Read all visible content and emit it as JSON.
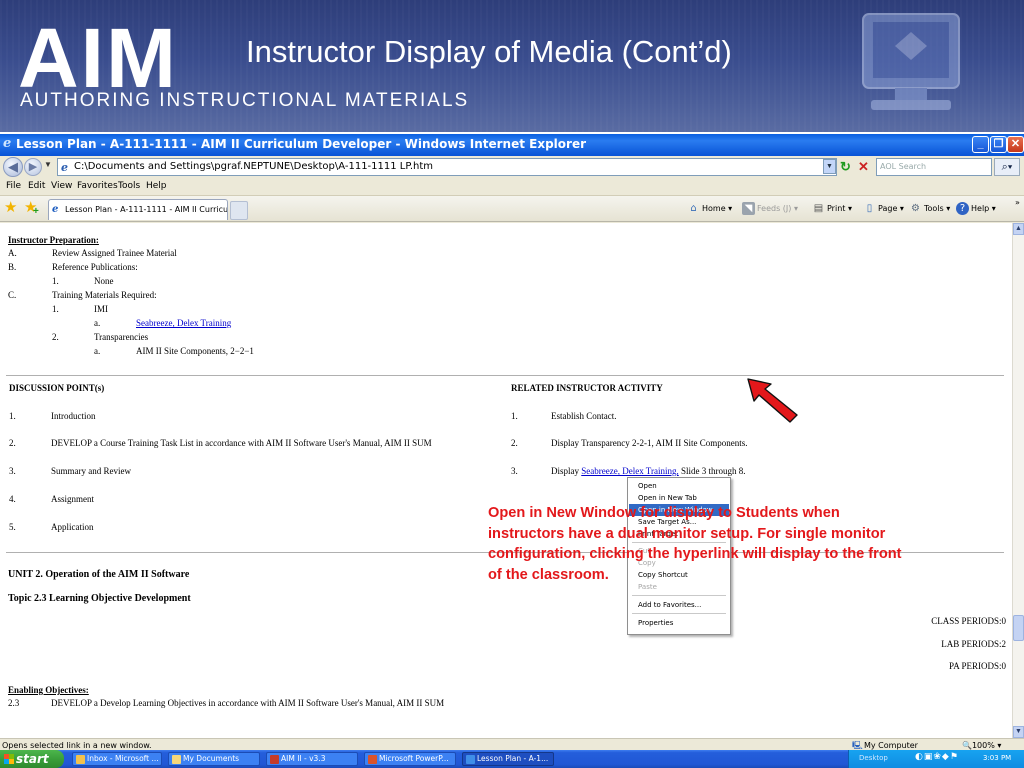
{
  "slide": {
    "logo": "AIM",
    "logo_subtitle": "AUTHORING INSTRUCTIONAL MATERIALS",
    "title": "Instructor Display of Media (Cont’d)"
  },
  "browser": {
    "window_title": "Lesson Plan - A-111-1111 - AIM II Curriculum Developer - Windows Internet Explorer",
    "address": "C:\\Documents and Settings\\pgraf.NEPTUNE\\Desktop\\A-111-1111 LP.htm",
    "search_placeholder": "AOL Search",
    "menu": [
      "File",
      "Edit",
      "View",
      "Favorites",
      "Tools",
      "Help"
    ],
    "tab_title": "Lesson Plan - A-111-1111 - AIM II Curriculu...",
    "commands": {
      "home": "Home",
      "feeds": "Feeds (J)",
      "print": "Print",
      "page": "Page",
      "tools": "Tools",
      "help": "Help"
    },
    "status_text": "Opens selected link in a new window.",
    "zone": "My Computer",
    "zoom": "100%"
  },
  "doc": {
    "prep_heading": "Instructor Preparation:",
    "prep": [
      {
        "num": "A.",
        "text": "Review Assigned Trainee Material"
      },
      {
        "num": "B.",
        "text": "Reference Publications:"
      },
      {
        "num": "1.",
        "text": "None"
      },
      {
        "num": "C.",
        "text": "Training Materials Required:"
      },
      {
        "num": "1.",
        "text": "IMI"
      },
      {
        "num": "a.",
        "text": "Seabreeze, Delex Training"
      },
      {
        "num": "2.",
        "text": "Transparencies"
      },
      {
        "num": "a.",
        "text": "AIM II Site Components, 2−2−1"
      }
    ],
    "discussion_heading": "DISCUSSION POINT(s)",
    "activity_heading": "RELATED INSTRUCTOR ACTIVITY",
    "discussion": [
      {
        "num": "1.",
        "text": "Introduction"
      },
      {
        "num": "2.",
        "text": "DEVELOP a Course Training Task List in accordance with AIM II Software User's Manual, AIM II SUM"
      },
      {
        "num": "3.",
        "text": "Summary and Review"
      },
      {
        "num": "4.",
        "text": "Assignment"
      },
      {
        "num": "5.",
        "text": "Application"
      }
    ],
    "activity": [
      {
        "num": "1.",
        "text": "Establish Contact."
      },
      {
        "num": "2.",
        "text": "Display Transparency 2-2-1, AIM II Site Components."
      },
      {
        "num": "3.",
        "pre": "Display ",
        "link": "Seabreeze, Delex Training,",
        "post": " Slide 3 through 8."
      }
    ],
    "unit_title": "UNIT 2. Operation of the AIM II Software",
    "topic_title": "Topic 2.3 Learning Objective Development",
    "periods": [
      "CLASS PERIODS:0",
      "LAB PERIODS:2",
      "PA PERIODS:0"
    ],
    "enabling_heading": "Enabling Objectives:",
    "enabling": {
      "num": "2.3",
      "text": "DEVELOP a Develop Learning Objectives in accordance with AIM II Software User's Manual, AIM II SUM"
    }
  },
  "context_menu": {
    "items": [
      {
        "label": "Open",
        "state": "normal"
      },
      {
        "label": "Open in New Tab",
        "state": "normal"
      },
      {
        "label": "Open in New Window",
        "state": "highlighted"
      },
      {
        "label": "Save Target As...",
        "state": "normal"
      },
      {
        "label": "Print Target",
        "state": "normal"
      },
      {
        "label": "Cut",
        "state": "disabled"
      },
      {
        "label": "Copy",
        "state": "disabled"
      },
      {
        "label": "Copy Shortcut",
        "state": "normal"
      },
      {
        "label": "Paste",
        "state": "disabled"
      },
      {
        "label": "Add to Favorites...",
        "state": "normal"
      },
      {
        "label": "Properties",
        "state": "normal"
      }
    ]
  },
  "annotation": {
    "text": "Open in New Window for display to Students when instructors have a dual monitor setup. For single monitor configuration, clicking the hyperlink will display to the front of the classroom.",
    "color": "#e3181b"
  },
  "taskbar": {
    "start": "start",
    "tasks": [
      "Inbox - Microsoft ...",
      "My Documents",
      "AIM II - v3.3",
      "Microsoft PowerP...",
      "Lesson Plan - A-1..."
    ],
    "tray_label": "Desktop",
    "clock": "3:03 PM"
  },
  "colors": {
    "banner": "#3a4d8e",
    "title_bar": "#0a5fe0",
    "link": "#0000cc",
    "menu_highlight": "#316ac5",
    "taskbar": "#245edb",
    "start_button": "#3a9e3a"
  }
}
